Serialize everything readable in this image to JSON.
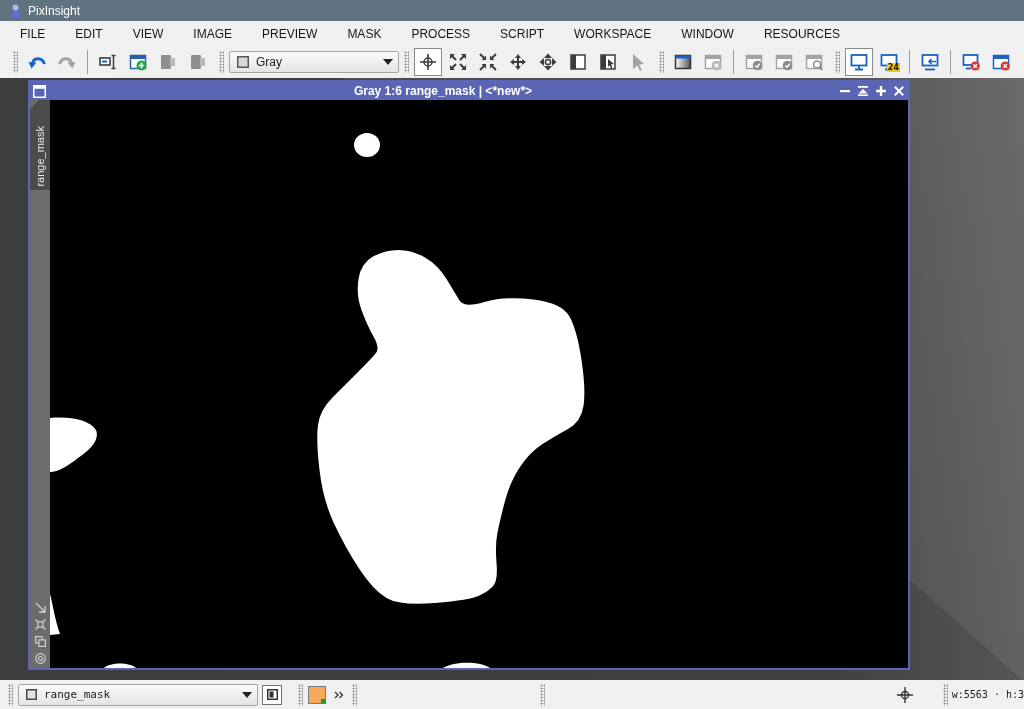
{
  "app": {
    "title": "PixInsight"
  },
  "menu": [
    "FILE",
    "EDIT",
    "VIEW",
    "IMAGE",
    "PREVIEW",
    "MASK",
    "PROCESS",
    "SCRIPT",
    "WORKSPACE",
    "WINDOW",
    "RESOURCES"
  ],
  "toolbar": {
    "history": [
      {
        "disabled": false
      },
      {
        "disabled": true
      }
    ],
    "view_actions": [
      {
        "disabled": false
      },
      {
        "disabled": false
      },
      {
        "disabled": true
      },
      {
        "disabled": true
      }
    ],
    "view_selector": {
      "value": "Gray"
    },
    "modes": [
      {
        "selected": true,
        "disabled": false
      },
      {
        "selected": false,
        "disabled": false
      },
      {
        "selected": false,
        "disabled": false
      },
      {
        "selected": false,
        "disabled": false
      },
      {
        "selected": false,
        "disabled": false
      },
      {
        "selected": false,
        "disabled": false
      },
      {
        "selected": false,
        "disabled": false
      },
      {
        "selected": false,
        "disabled": true
      }
    ],
    "preview_actions": [
      {
        "disabled": false
      },
      {
        "disabled": true
      }
    ],
    "mask_actions": [
      {
        "disabled": true
      },
      {
        "disabled": true
      },
      {
        "disabled": true
      }
    ],
    "display": [
      {
        "selected": true
      },
      {
        "selected": false,
        "badge": "24"
      }
    ]
  },
  "image_window": {
    "title": "Gray 1:6 range_mask | <*new*>",
    "tab": "range_mask"
  },
  "status_bar": {
    "view_selector": {
      "value": "range_mask"
    },
    "readout": "w:5563 · h:3"
  }
}
